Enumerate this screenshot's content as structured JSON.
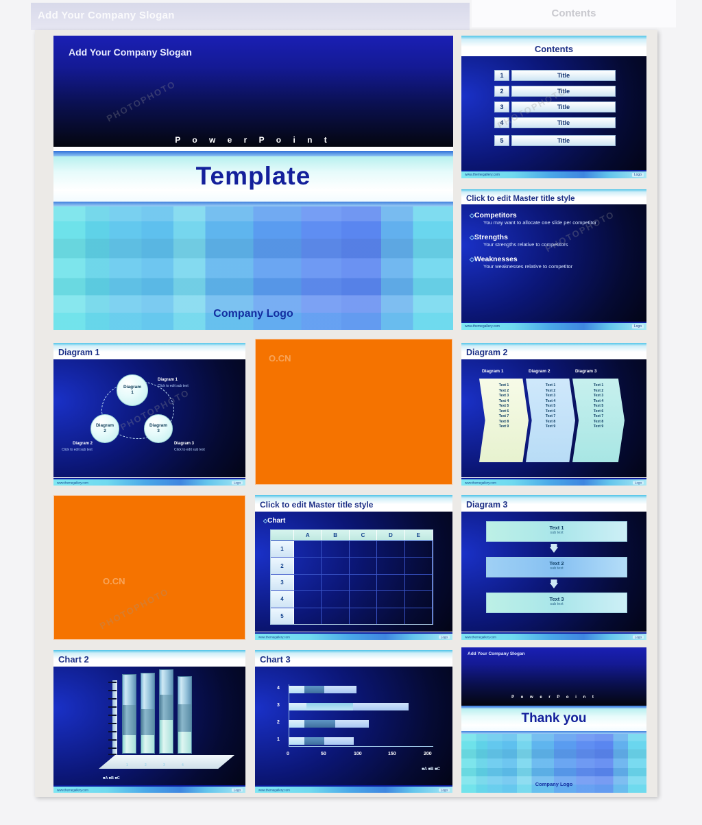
{
  "ghost": {
    "slogan": "Add Your Company Slogan",
    "contents_title": "Contents"
  },
  "common": {
    "footer_url": "www.themegallery.com",
    "footer_logo": "Logo"
  },
  "title_slide": {
    "slogan": "Add Your Company Slogan",
    "powerpoint": "P o w e r P o i n t",
    "template": "Template",
    "company_logo": "Company Logo"
  },
  "contents_slide": {
    "heading": "Contents",
    "rows": [
      {
        "num": "1",
        "title": "Title"
      },
      {
        "num": "2",
        "title": "Title"
      },
      {
        "num": "3",
        "title": "Title"
      },
      {
        "num": "4",
        "title": "Title"
      },
      {
        "num": "5",
        "title": "Title"
      }
    ]
  },
  "competitors_slide": {
    "heading": "Click to edit Master title style",
    "blocks": [
      {
        "head": "Competitors",
        "sub": "You may want to allocate one slide per competitor"
      },
      {
        "head": "Strengths",
        "sub": "Your strengths relative to competitors"
      },
      {
        "head": "Weaknesses",
        "sub": "Your weaknesses relative to competitor"
      }
    ]
  },
  "diagram1_slide": {
    "heading": "Diagram 1",
    "circles": [
      {
        "l1": "Diagram",
        "l2": "1"
      },
      {
        "l1": "Diagram",
        "l2": "2"
      },
      {
        "l1": "Diagram",
        "l2": "3"
      }
    ],
    "labels": [
      {
        "title": "Diagram 1",
        "sub": "Click to edit sub text"
      },
      {
        "title": "Diagram 2",
        "sub": "Click to edit sub text"
      },
      {
        "title": "Diagram 3",
        "sub": "Click to edit sub text"
      }
    ]
  },
  "diagram2_slide": {
    "heading": "Diagram 2",
    "columns": [
      {
        "label": "Diagram 1",
        "items": [
          "Text 1",
          "Text 2",
          "Text 3",
          "Text 4",
          "Text 5",
          "Text 6",
          "Text 7",
          "Text 8",
          "Text 9"
        ]
      },
      {
        "label": "Diagram 2",
        "items": [
          "Text 1",
          "Text 2",
          "Text 3",
          "Text 4",
          "Text 5",
          "Text 6",
          "Text 7",
          "Text 8",
          "Text 9"
        ]
      },
      {
        "label": "Diagram 3",
        "items": [
          "Text 1",
          "Text 2",
          "Text 3",
          "Text 4",
          "Text 5",
          "Text 6",
          "Text 7",
          "Text 8",
          "Text 9"
        ]
      }
    ]
  },
  "diagram3_slide": {
    "heading": "Diagram 3",
    "bars": [
      {
        "title": "Text 1",
        "sub": "sub text"
      },
      {
        "title": "Text 2",
        "sub": "sub text"
      },
      {
        "title": "Text 3",
        "sub": "sub text"
      }
    ]
  },
  "table_slide": {
    "heading": "Click to edit Master title style",
    "chart_label": "Chart",
    "columns": [
      "",
      "A",
      "B",
      "C",
      "D",
      "E"
    ],
    "rows": [
      "1",
      "2",
      "3",
      "4",
      "5"
    ]
  },
  "chart2_slide": {
    "heading": "Chart 2"
  },
  "chart3_slide": {
    "heading": "Chart 3"
  },
  "thankyou_slide": {
    "slogan": "Add Your Company Slogan",
    "powerpoint": "P o w e r P o i n t",
    "thanks": "Thank you",
    "company_logo": "Company Logo"
  },
  "watermarks": {
    "photo": "PHOTOPHOTO",
    "cn": "O.CN"
  },
  "chart_data": [
    {
      "type": "bar",
      "title": "Chart 2",
      "orientation": "vertical-3d-stacked",
      "categories": [
        "1",
        "2",
        "3",
        "4"
      ],
      "legend": [
        "A",
        "B",
        "C"
      ],
      "legend_position": "bottom-left",
      "series": [
        {
          "name": "A",
          "values": [
            20,
            20,
            38,
            25
          ]
        },
        {
          "name": "B",
          "values": [
            40,
            34,
            30,
            38
          ]
        },
        {
          "name": "C",
          "values": [
            40,
            46,
            32,
            37
          ]
        }
      ],
      "ylabel": "",
      "xlabel": "",
      "ylim": [
        0,
        100
      ],
      "grid": false
    },
    {
      "type": "bar",
      "title": "Chart 3",
      "orientation": "horizontal-stacked",
      "categories": [
        "1",
        "2",
        "3",
        "4"
      ],
      "xticks": [
        0,
        50,
        100,
        150,
        200
      ],
      "legend": [
        "A",
        "B",
        "C"
      ],
      "legend_position": "bottom-right",
      "series": [
        {
          "name": "A",
          "values": [
            22,
            22,
            25,
            22
          ]
        },
        {
          "name": "B",
          "values": [
            28,
            43,
            65,
            28
          ]
        },
        {
          "name": "C",
          "values": [
            45,
            47,
            77,
            50
          ]
        }
      ],
      "xlabel": "",
      "ylabel": "",
      "xlim": [
        0,
        200
      ],
      "grid": false
    },
    {
      "type": "table",
      "title": "Chart",
      "columns": [
        "",
        "A",
        "B",
        "C",
        "D",
        "E"
      ],
      "rows": [
        {
          "label": "1",
          "cells": [
            "",
            "",
            "",
            "",
            ""
          ]
        },
        {
          "label": "2",
          "cells": [
            "",
            "",
            "",
            "",
            ""
          ]
        },
        {
          "label": "3",
          "cells": [
            "",
            "",
            "",
            "",
            ""
          ]
        },
        {
          "label": "4",
          "cells": [
            "",
            "",
            "",
            "",
            ""
          ]
        },
        {
          "label": "5",
          "cells": [
            "",
            "",
            "",
            "",
            ""
          ]
        }
      ]
    }
  ]
}
